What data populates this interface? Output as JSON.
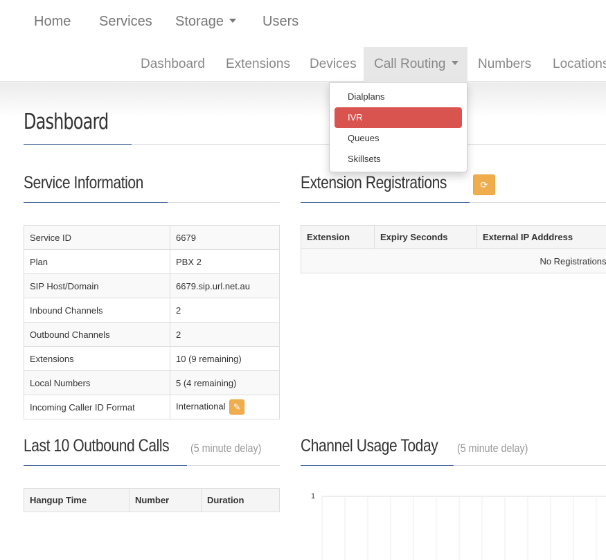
{
  "topnav": {
    "items": [
      {
        "label": "Home"
      },
      {
        "label": "Services"
      },
      {
        "label": "Storage"
      },
      {
        "label": "Users"
      }
    ]
  },
  "subnav": {
    "items": [
      {
        "label": "Dashboard"
      },
      {
        "label": "Extensions"
      },
      {
        "label": "Devices"
      },
      {
        "label": "Call Routing"
      },
      {
        "label": "Numbers"
      },
      {
        "label": "Locations"
      }
    ],
    "dropdown": [
      {
        "label": "Dialplans"
      },
      {
        "label": "IVR"
      },
      {
        "label": "Queues"
      },
      {
        "label": "Skillsets"
      }
    ]
  },
  "page": {
    "title": "Dashboard"
  },
  "service_info": {
    "title": "Service Information",
    "rows": [
      {
        "key": "Service ID",
        "value": "6679"
      },
      {
        "key": "Plan",
        "value": "PBX 2"
      },
      {
        "key": "SIP Host/Domain",
        "value": "6679.sip.url.net.au"
      },
      {
        "key": "Inbound Channels",
        "value": "2"
      },
      {
        "key": "Outbound Channels",
        "value": "2"
      },
      {
        "key": "Extensions",
        "value": "10 (9 remaining)"
      },
      {
        "key": "Local Numbers",
        "value": "5 (4 remaining)"
      },
      {
        "key": "Incoming Caller ID Format",
        "value": "International"
      }
    ]
  },
  "registrations": {
    "title": "Extension Registrations",
    "columns": [
      "Extension",
      "Expiry Seconds",
      "External IP Adddress"
    ],
    "empty_text": "No Registrations"
  },
  "outbound": {
    "title": "Last 10 Outbound Calls",
    "delay": "(5 minute delay)",
    "columns": [
      "Hangup Time",
      "Number",
      "Duration"
    ]
  },
  "channel_usage": {
    "title": "Channel Usage Today",
    "delay": "(5 minute delay)"
  },
  "chart_data": {
    "type": "line",
    "title": "",
    "y_ticks": [
      "1"
    ],
    "series": []
  },
  "colors": {
    "accent_red": "#d9534f",
    "warning_orange": "#f0ad4e",
    "underline_blue": "#4a6a9a"
  }
}
